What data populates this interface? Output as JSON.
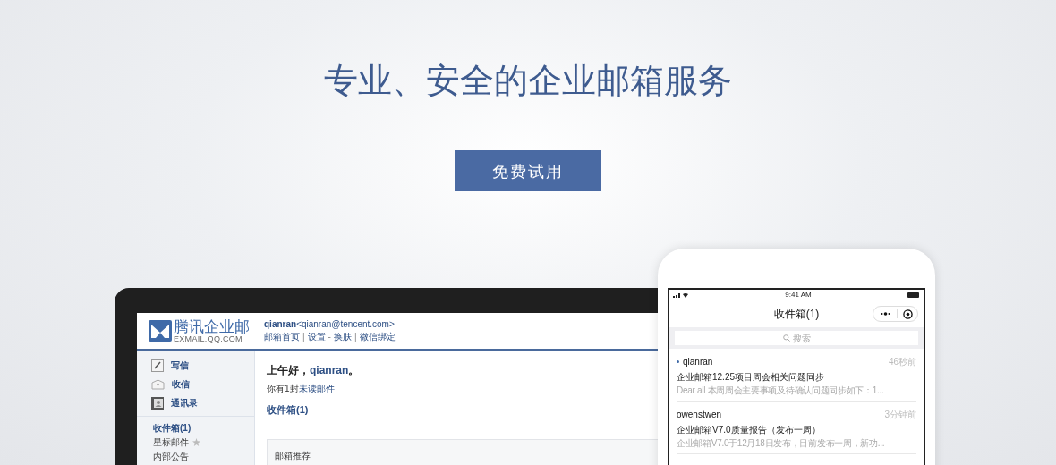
{
  "hero": {
    "title": "专业、安全的企业邮箱服务",
    "cta": "免费试用"
  },
  "laptop": {
    "logo": {
      "name": "腾讯企业邮",
      "domain": "EXMAIL.QQ.COM"
    },
    "user": {
      "name": "qianran",
      "email": "<qianran@tencent.com>"
    },
    "nav": [
      {
        "kind": "link",
        "text": "邮箱首页"
      },
      {
        "kind": "sep",
        "text": "|"
      },
      {
        "kind": "link",
        "text": "设置"
      },
      {
        "kind": "sep",
        "text": "-"
      },
      {
        "kind": "link",
        "text": "换肤"
      },
      {
        "kind": "sep",
        "text": "|"
      },
      {
        "kind": "link",
        "text": "微信绑定"
      }
    ],
    "actions": [
      {
        "kind": "compose",
        "label": "写信"
      },
      {
        "kind": "receive",
        "label": "收信"
      },
      {
        "kind": "contacts",
        "label": "通讯录"
      }
    ],
    "folders": [
      {
        "label": "收件箱(1)",
        "starred": false
      },
      {
        "label": "星标邮件",
        "starred": true
      },
      {
        "label": "内部公告",
        "starred": false
      }
    ],
    "greeting": {
      "prefix": "上午好，",
      "name": "qianran",
      "suffix": "。"
    },
    "unread": {
      "prefix": "你有1封",
      "link": "未读邮件"
    },
    "inbox_link": "收件箱(1)",
    "panel_title": "邮箱推荐"
  },
  "phone": {
    "time": "9:41 AM",
    "title": "收件箱(1)",
    "search_placeholder": "搜索",
    "messages": [
      {
        "sender": "qianran",
        "time": "46秒前",
        "subject": "企业邮箱12.25项目周会相关问题同步",
        "preview": "Dear all 本周周会主要事项及待确认问题同步如下：1...",
        "unread": true
      },
      {
        "sender": "owenstwen",
        "time": "3分钟前",
        "subject": "企业邮箱V7.0质量报告（发布一周）",
        "preview": "企业邮箱V7.0于12月18日发布，目前发布一周，新功...",
        "unread": false
      }
    ]
  }
}
